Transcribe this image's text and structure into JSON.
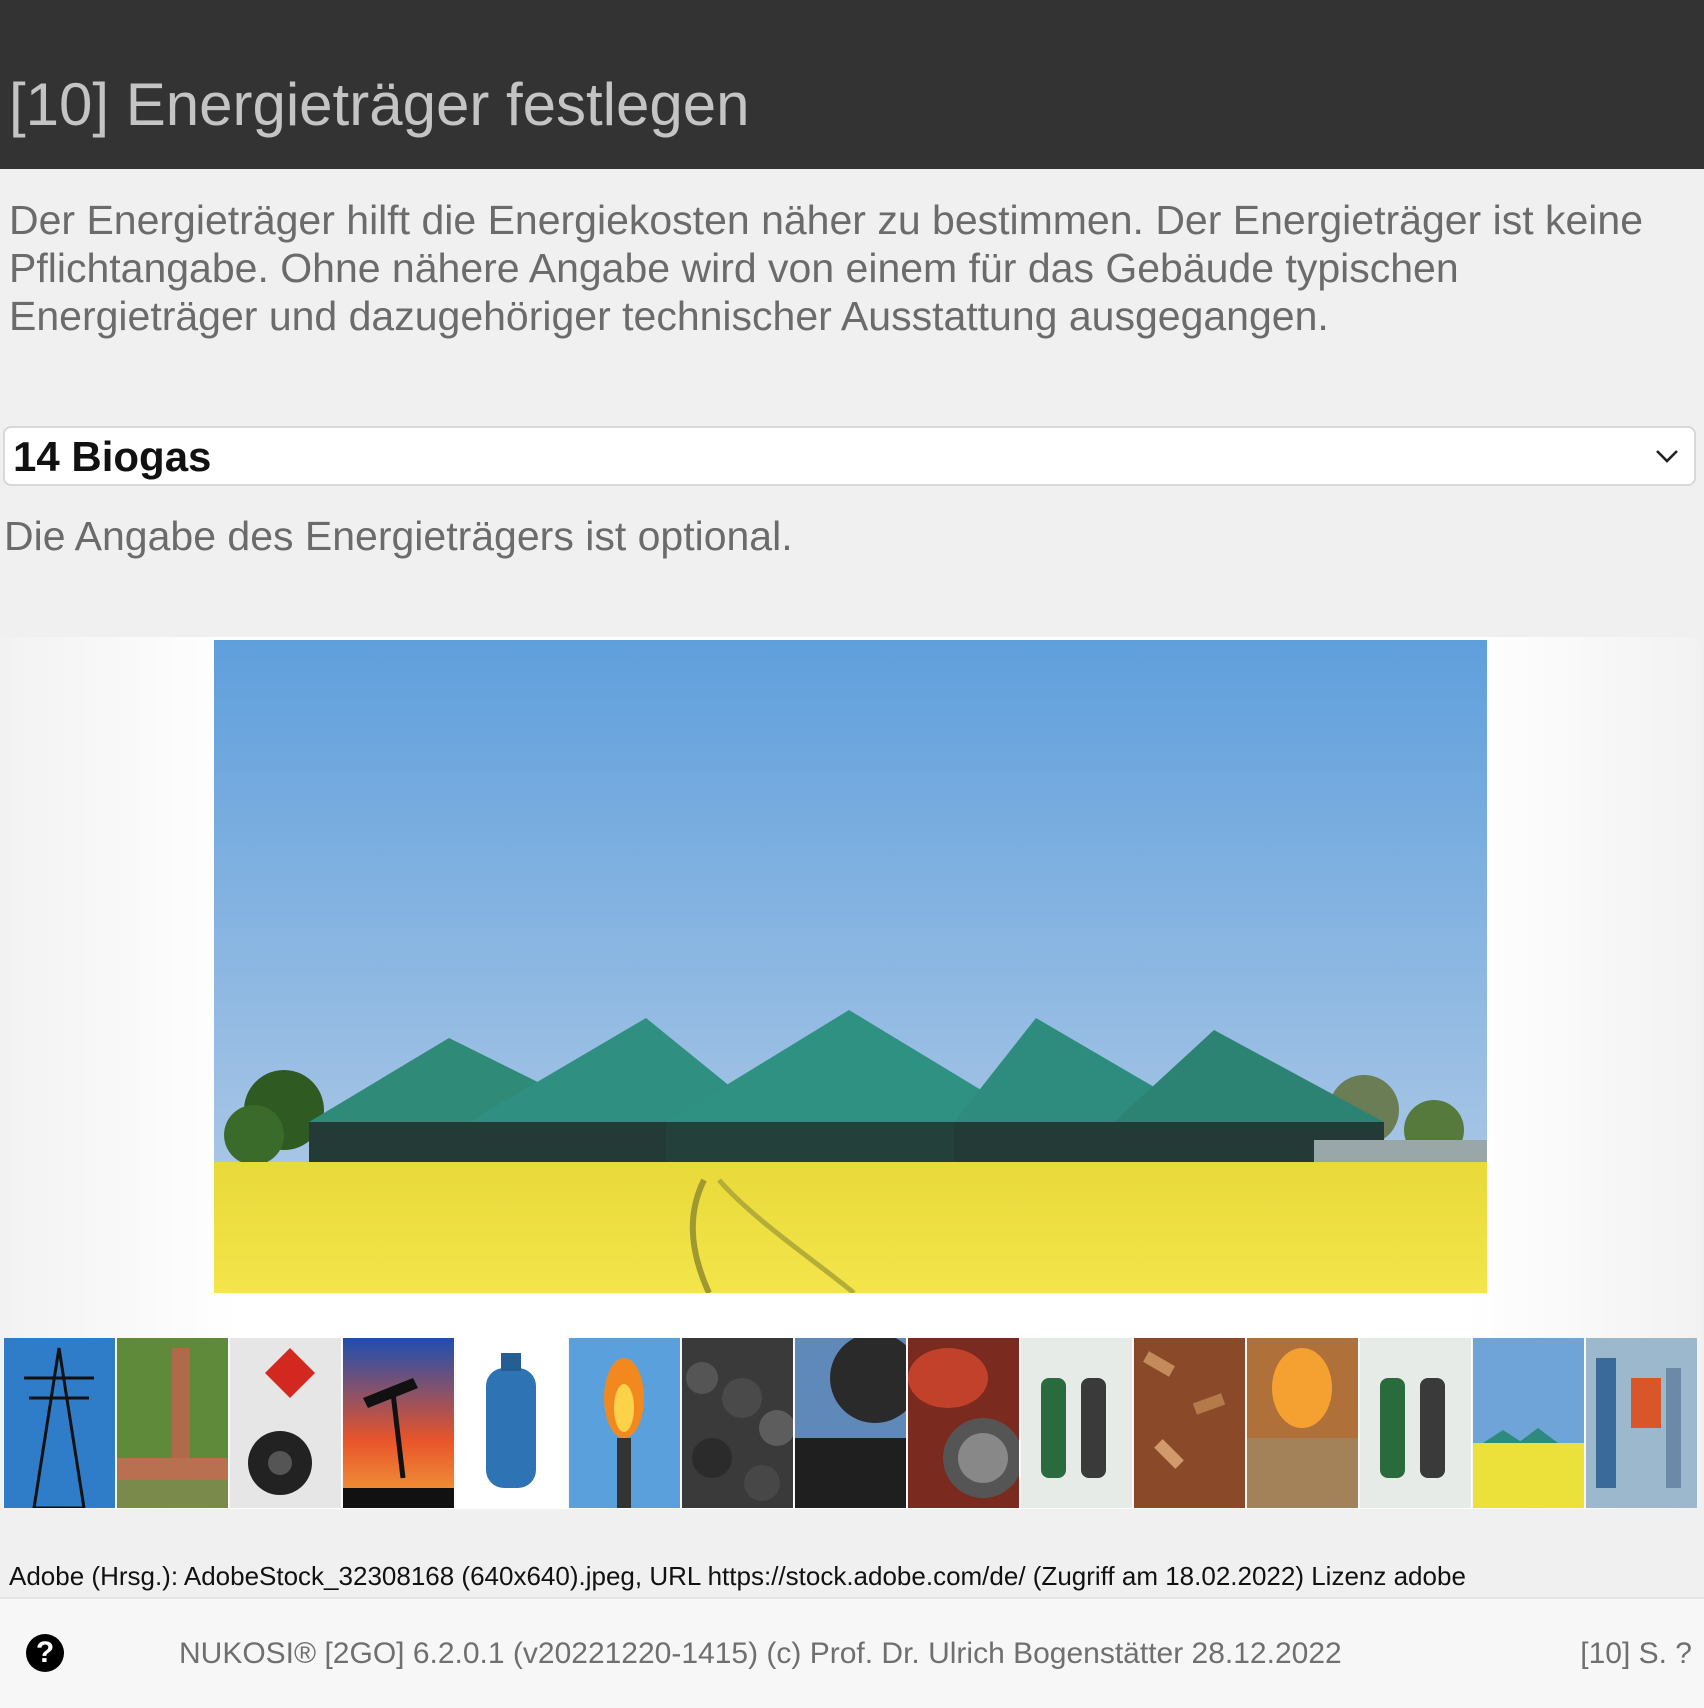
{
  "header": {
    "title": "[10] Energieträger festlegen"
  },
  "intro": "Der Energieträger hilft die Energiekosten näher zu bestimmen. Der Energieträger ist keine Pflichtangabe. Ohne nähere Angabe wird von einem für das Gebäude typischen Energieträger und dazugehöriger technischer Ausstattung ausgegangen.",
  "select": {
    "value": "14 Biogas",
    "icon": "chevron-down-icon"
  },
  "hint": "Die Angabe des Energieträgers ist optional.",
  "main_image": {
    "subject": "biogas-plant",
    "colors": {
      "sky": "#6fa4d8",
      "domes": "#2e8a7e",
      "field": "#f0e030"
    }
  },
  "thumbnails": [
    {
      "name": "thumb-power-pylon"
    },
    {
      "name": "thumb-district-heating-pipes"
    },
    {
      "name": "thumb-gas-hazard-sign"
    },
    {
      "name": "thumb-oil-pump"
    },
    {
      "name": "thumb-gas-bottle"
    },
    {
      "name": "thumb-gas-flare"
    },
    {
      "name": "thumb-coal-pile"
    },
    {
      "name": "thumb-coal-excavator"
    },
    {
      "name": "thumb-oil-barrels"
    },
    {
      "name": "thumb-fuel-nozzles"
    },
    {
      "name": "thumb-wood-chips"
    },
    {
      "name": "thumb-wood-pellets"
    },
    {
      "name": "thumb-fuel-nozzles-2"
    },
    {
      "name": "thumb-biogas-plant"
    },
    {
      "name": "thumb-heat-pump-installation"
    }
  ],
  "credit": "Adobe (Hrsg.): AdobeStock_32308168 (640x640).jpeg, URL https://stock.adobe.com/de/ (Zugriff am 18.02.2022) Lizenz adobe",
  "footer": {
    "help": "?",
    "version": "NUKOSI® [2GO] 6.2.0.1 (v20221220-1415) (c) Prof. Dr. Ulrich Bogenstätter  28.12.2022",
    "page": "[10] S. ?"
  }
}
